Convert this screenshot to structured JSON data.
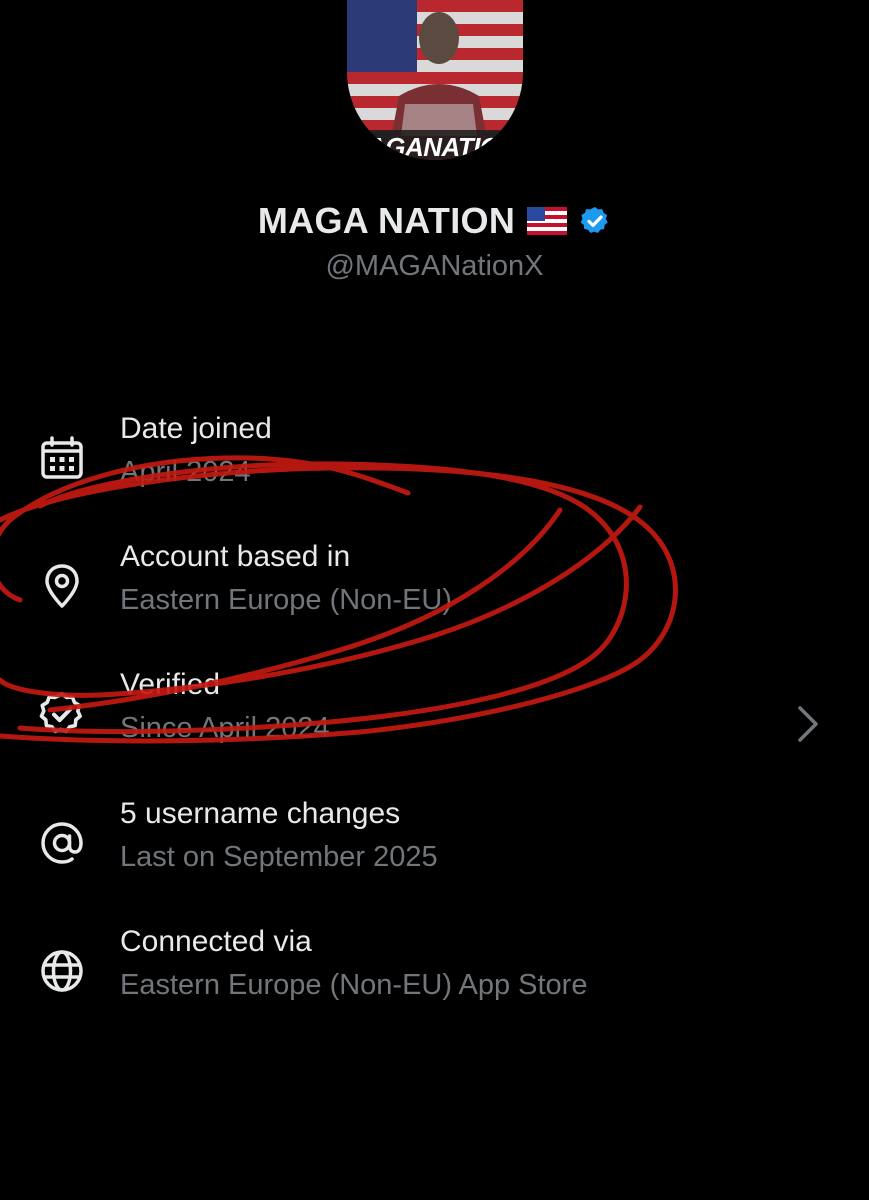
{
  "profile": {
    "display_name": "MAGA NATION",
    "flag_emoji": "🇺🇸",
    "verified_badge": "verified-check-icon",
    "handle": "@MAGANationX",
    "avatar_text": "AGANATIC"
  },
  "info": [
    {
      "icon": "calendar-icon",
      "title": "Date joined",
      "subtitle": "April 2024"
    },
    {
      "icon": "location-pin-icon",
      "title": "Account based in",
      "subtitle": "Eastern Europe (Non-EU)"
    },
    {
      "icon": "verified-badge-icon",
      "title": "Verified",
      "subtitle": "Since April 2024"
    },
    {
      "icon": "at-sign-icon",
      "title": "5 username changes",
      "subtitle": "Last on September 2025"
    },
    {
      "icon": "globe-icon",
      "title": "Connected via",
      "subtitle": "Eastern Europe (Non-EU) App Store"
    }
  ],
  "colors": {
    "background": "#000000",
    "primary_text": "#e7e9ea",
    "secondary_text": "#71767b",
    "verified_blue": "#1d9bf0",
    "annotation_red": "#c41a12"
  }
}
